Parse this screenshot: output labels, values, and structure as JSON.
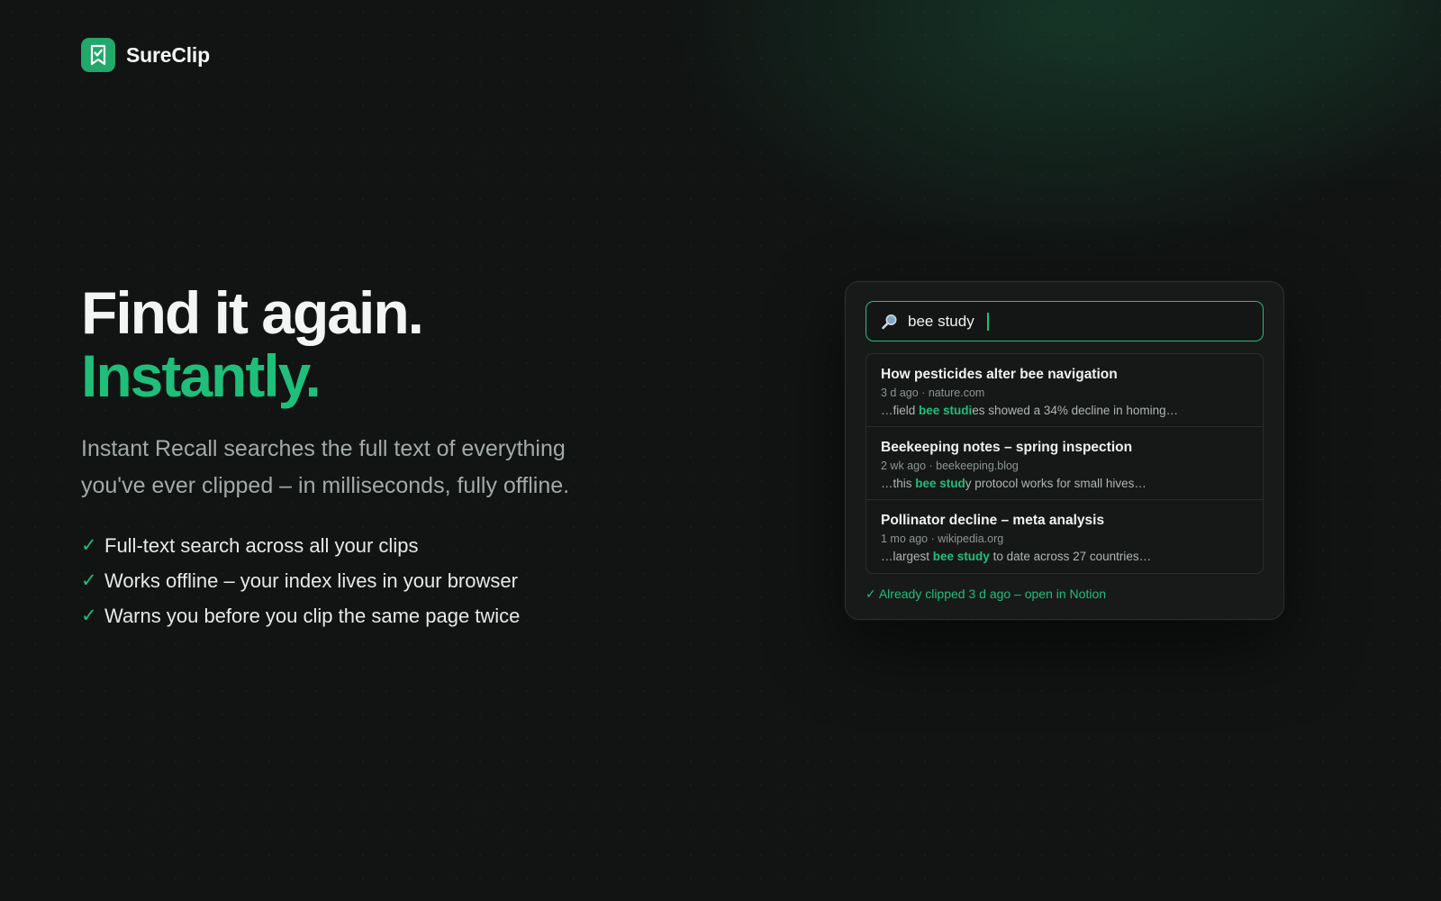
{
  "brand": {
    "name": "SureClip",
    "icon": "bookmark-check-icon",
    "color": "#22a86a"
  },
  "hero": {
    "headline": "Find it again.",
    "headline_accent": "Instantly.",
    "subtitle": "Instant Recall searches the full text of everything you've ever clipped – in milliseconds, fully offline.",
    "features": [
      {
        "icon": "checkmark-icon",
        "text": "Full-text search across all your clips"
      },
      {
        "icon": "checkmark-icon",
        "text": "Works offline – your index lives in your browser"
      },
      {
        "icon": "checkmark-icon",
        "text": "Warns you before you clip the same page twice"
      }
    ]
  },
  "demo": {
    "search": {
      "icon": "magnifier-icon",
      "value": "bee study"
    },
    "results": [
      {
        "title": "How pesticides alter bee navigation",
        "meta": "3 d ago · nature.com",
        "snippet_before": "…field ",
        "snippet_match": "bee studi",
        "snippet_after": "es showed a 34% decline in homing…"
      },
      {
        "title": "Beekeeping notes – spring inspection",
        "meta": "2 wk ago · beekeeping.blog",
        "snippet_before": "…this ",
        "snippet_match": "bee stud",
        "snippet_after": "y protocol works for small hives…"
      },
      {
        "title": "Pollinator decline – meta analysis",
        "meta": "1 mo ago · wikipedia.org",
        "snippet_before": "…largest ",
        "snippet_match": "bee study",
        "snippet_after": " to date across 27 countries…"
      }
    ],
    "notice": "✓ Already clipped 3 d ago – open in Notion"
  },
  "colors": {
    "accent": "#1fbf7a",
    "background": "#111413",
    "card": "#181a19"
  }
}
